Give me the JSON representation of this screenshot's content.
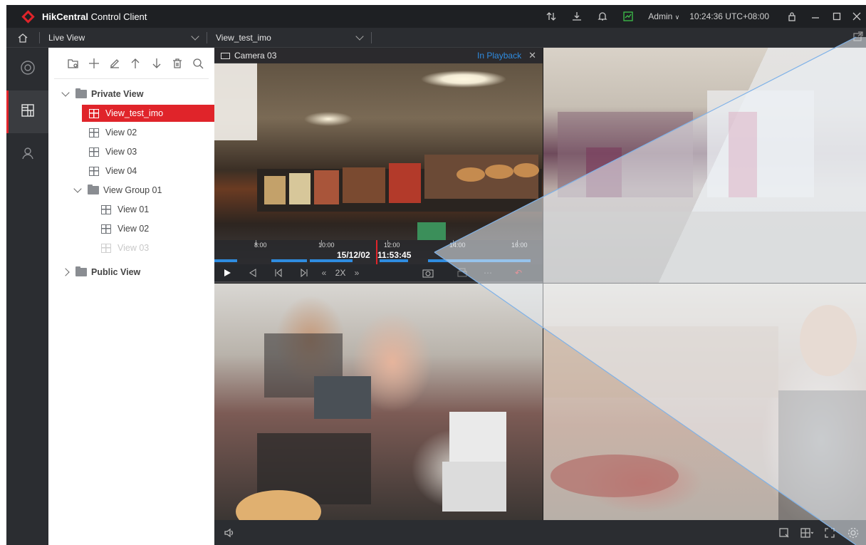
{
  "app": {
    "name_bold": "HikCentral",
    "name_rest": " Control Client"
  },
  "titlebar": {
    "user": "Admin",
    "clock": "10:24:36 UTC+08:00"
  },
  "nav": {
    "module": "Live View",
    "view": "View_test_imo"
  },
  "tree": {
    "private_view": "Private View",
    "selected": "View_test_imo",
    "views": [
      "View 02",
      "View 03",
      "View 04"
    ],
    "group": "View Group 01",
    "group_views": [
      "View 01",
      "View 02",
      "View 03"
    ],
    "public_view": "Public View"
  },
  "camera": {
    "name": "Camera 03",
    "status": "In Playback",
    "timeline": {
      "labels": [
        "8:00",
        "10:00",
        "12:00",
        "14:00",
        "16:00"
      ],
      "date": "15/12/02",
      "time": "11:53:45"
    },
    "speed": "2X"
  },
  "colors": {
    "accent": "#e0242a",
    "link": "#2f8ce0"
  }
}
